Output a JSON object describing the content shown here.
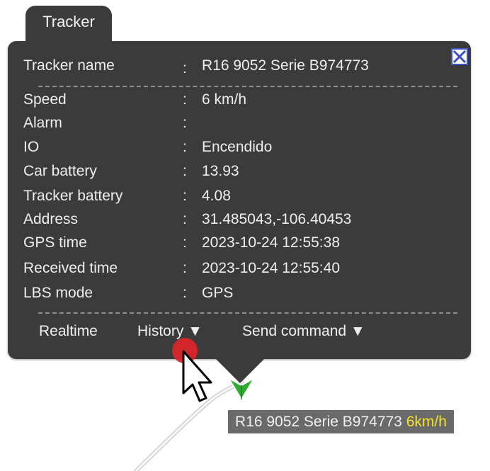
{
  "tab": {
    "label": "Tracker"
  },
  "popup": {
    "separator": ":",
    "tracker_name": {
      "label": "Tracker name",
      "value": "R16 9052 Serie B974773"
    },
    "rows": [
      {
        "label": "Speed",
        "value": "6 km/h"
      },
      {
        "label": "Alarm",
        "value": ""
      },
      {
        "label": "IO",
        "value": "Encendido"
      },
      {
        "label": "Car battery",
        "value": "13.93"
      },
      {
        "label": "Tracker battery",
        "value": "4.08"
      },
      {
        "label": "Address",
        "value": "31.485043,-106.40453"
      },
      {
        "label": "GPS time",
        "value": "2023-10-24 12:55:38"
      },
      {
        "label": "Received time",
        "value": "2023-10-24 12:55:40"
      },
      {
        "label": "LBS mode",
        "value": "GPS"
      }
    ],
    "actions": {
      "realtime": "Realtime",
      "history": "History ▼",
      "send_command": "Send command ▼"
    }
  },
  "map_label": {
    "name": "R16 9052 Serie B974773",
    "speed": "6km/h"
  },
  "icons": {
    "close": "close-icon",
    "marker": "vehicle-direction-marker-icon",
    "cursor": "mouse-pointer-icon"
  },
  "colors": {
    "panel": "#3b3b3b",
    "speed_highlight": "#f5e32a",
    "marker": "#2fae2f",
    "close_border": "#3d52c5",
    "click_indicator": "#d9262a"
  }
}
